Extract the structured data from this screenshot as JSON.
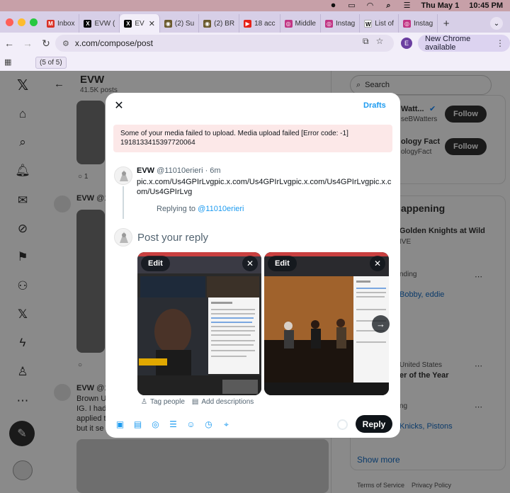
{
  "menubar": {
    "date": "Thu May 1",
    "time": "10:45 PM"
  },
  "browser": {
    "tabs": [
      {
        "title": "Inbox",
        "color": "#d93025",
        "glyph": "M"
      },
      {
        "title": "EVW (",
        "color": "#000000",
        "glyph": "X"
      },
      {
        "title": "EV",
        "color": "#000000",
        "glyph": "X",
        "active": true
      },
      {
        "title": "(2) Su",
        "color": "#6b5a2e",
        "glyph": "◉"
      },
      {
        "title": "(2) BR",
        "color": "#6b5a2e",
        "glyph": "◉"
      },
      {
        "title": "18 acc",
        "color": "#e62117",
        "glyph": "▶"
      },
      {
        "title": "Middle",
        "color": "#c13584",
        "glyph": "◎"
      },
      {
        "title": "Instag",
        "color": "#c13584",
        "glyph": "◎"
      },
      {
        "title": "List of",
        "color": "#ffffff",
        "glyph": "W"
      },
      {
        "title": "Instag",
        "color": "#c13584",
        "glyph": "◎"
      }
    ],
    "url": "x.com/compose/post",
    "profile_initial": "E",
    "new_chrome_label": "New Chrome available",
    "tooltip": "(5 of 5)"
  },
  "timeline": {
    "title": "EVW",
    "post_count": "41.5K posts",
    "reply_count": "1",
    "post2_name": "EVW",
    "post2_handle": "@11",
    "post3_name": "EVW",
    "post3_handle": "@11",
    "post3_lines": [
      "Brown U",
      "IG. I had",
      "applied t",
      "but it se"
    ]
  },
  "sidebar": {
    "search_placeholder": "Search",
    "who_to_follow": [
      {
        "name": "Watt...",
        "handle": "seBWatters",
        "button": "Follow"
      },
      {
        "name": "ology Fact",
        "handle": "ologyFact",
        "button": "Follow"
      }
    ],
    "happening_title": "appening",
    "trends": [
      {
        "title": "Golden Knights at Wild",
        "sub": "IVE"
      },
      {
        "meta": "nding",
        "links": "Bobby, eddie"
      },
      {
        "meta": "United States",
        "title": "er of the Year"
      },
      {
        "meta": "ng",
        "links": "Knicks, Pistons"
      }
    ],
    "show_more": "Show more",
    "footer": [
      "Terms of Service",
      "Privacy Policy"
    ]
  },
  "modal": {
    "drafts_label": "Drafts",
    "error": "Some of your media failed to upload. Media upload failed [Error code: -1] 1918133415397720064",
    "parent": {
      "name": "EVW",
      "handle": "@11010erieri",
      "time": "· 6m",
      "text": "pic.x.com/Us4GPIrLvgpic.x.com/Us4GPIrLvgpic.x.com/Us4GPIrLvgpic.x.com/Us4GPIrLvg"
    },
    "replying_prefix": "Replying to",
    "replying_handle": "@11010erieri",
    "compose_placeholder": "Post your reply",
    "media_edit_label": "Edit",
    "tag_people": "Tag people",
    "add_descriptions": "Add descriptions",
    "reply_button": "Reply",
    "toolbar_icons": [
      "image-icon",
      "gif-icon",
      "grok-icon",
      "poll-icon",
      "emoji-icon",
      "schedule-icon",
      "location-icon"
    ]
  },
  "colors": {
    "accent": "#1d9bf0",
    "dark": "#0f1419",
    "error_bg": "#fce8e8"
  }
}
